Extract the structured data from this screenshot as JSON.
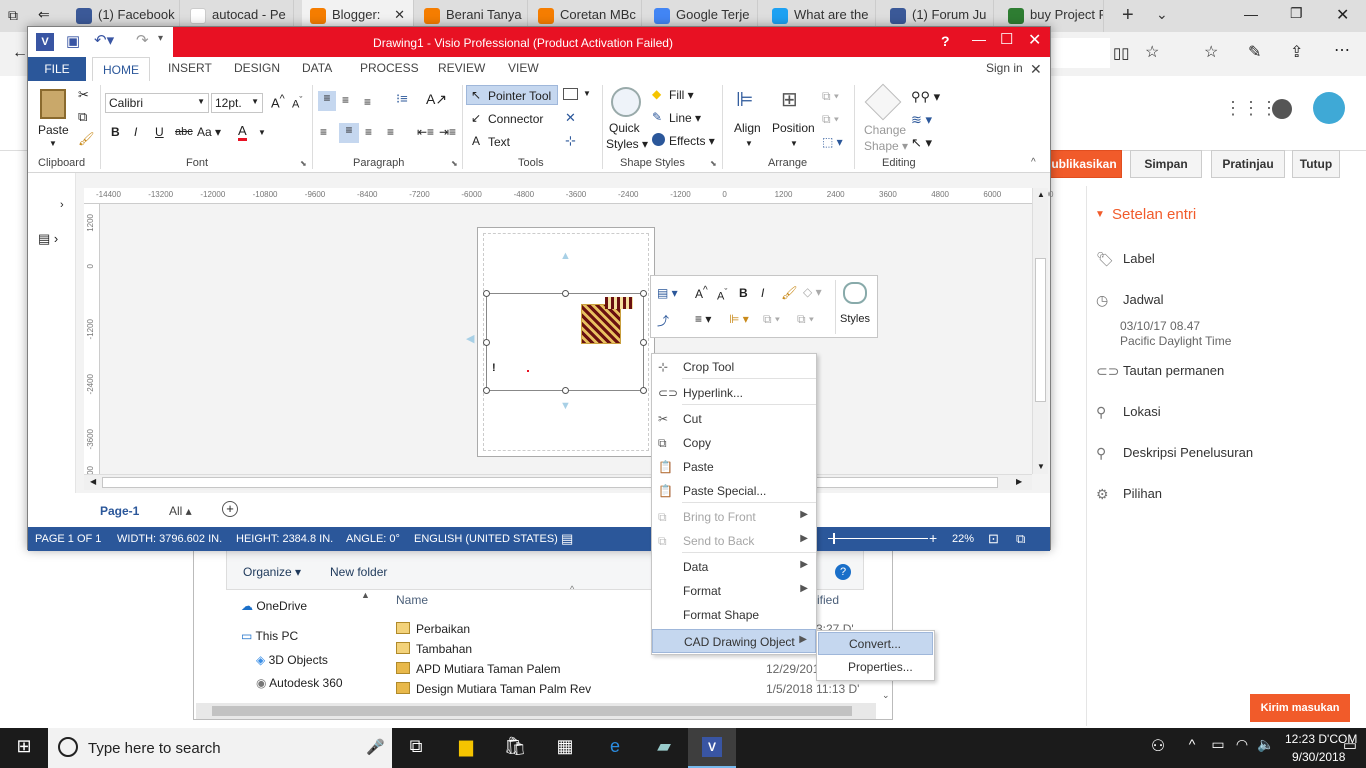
{
  "browser": {
    "tabs": [
      {
        "label": "(1) Facebook",
        "icon": "facebook-icon",
        "color": "#3b5998"
      },
      {
        "label": "autocad - Pe",
        "icon": "google-icon",
        "color": "#ffffff"
      },
      {
        "label": "Blogger:",
        "icon": "blogger-icon",
        "color": "#f57d00",
        "active": true
      },
      {
        "label": "Berani Tanya",
        "icon": "blogger-icon",
        "color": "#f57d00"
      },
      {
        "label": "Coretan MBc",
        "icon": "blogger-icon",
        "color": "#f57d00"
      },
      {
        "label": "Google Terje",
        "icon": "translate-icon",
        "color": "#4285f4"
      },
      {
        "label": "What are the",
        "icon": "twitter-icon",
        "color": "#1da1f2"
      },
      {
        "label": "(1) Forum Ju",
        "icon": "facebook-icon",
        "color": "#3b5998"
      },
      {
        "label": "buy Project P",
        "icon": "money-icon",
        "color": "#2e7d32"
      }
    ]
  },
  "blogger": {
    "buttons": {
      "publish": "ublikasikan",
      "save": "Simpan",
      "preview": "Pratinjau",
      "close": "Tutup"
    },
    "settings_title": "Setelan entri",
    "items": {
      "label": "Label",
      "schedule": "Jadwal",
      "schedule_date": "03/10/17 08.47",
      "schedule_tz": "Pacific Daylight Time",
      "permalink": "Tautan permanen",
      "location": "Lokasi",
      "search_desc": "Deskripsi Penelusuran",
      "options": "Pilihan"
    },
    "feedback": "Kirim masukan"
  },
  "visio": {
    "title": "Drawing1 -  Visio Professional (Product Activation Failed)",
    "signin": "Sign in",
    "tabs": [
      "FILE",
      "HOME",
      "INSERT",
      "DESIGN",
      "DATA",
      "PROCESS",
      "REVIEW",
      "VIEW"
    ],
    "ribbon": {
      "paste": "Paste",
      "font_name": "Calibri",
      "font_size": "12pt.",
      "pointer_tool": "Pointer Tool",
      "connector": "Connector",
      "text": "Text",
      "quick_styles_1": "Quick",
      "quick_styles_2": "Styles",
      "fill": "Fill",
      "line": "Line",
      "effects": "Effects",
      "align": "Align",
      "position": "Position",
      "change_shape_1": "Change",
      "change_shape_2": "Shape",
      "groups": {
        "clipboard": "Clipboard",
        "font": "Font",
        "paragraph": "Paragraph",
        "tools": "Tools",
        "shape_styles": "Shape Styles",
        "arrange": "Arrange",
        "editing": "Editing"
      }
    },
    "ruler_labels": [
      "-14400",
      "-13200",
      "-12000",
      "-10800",
      "-9600",
      "-8400",
      "-7200",
      "-6000",
      "-4800",
      "-3600",
      "-2400",
      "-1200",
      "0",
      "1200",
      "2400",
      "3600",
      "4800",
      "6000",
      "7200"
    ],
    "vruler_labels": [
      "1200",
      "0",
      "-1200",
      "-2400",
      "-3600",
      "-300"
    ],
    "page_tab": "Page-1",
    "all_tab": "All",
    "status": {
      "page": "PAGE 1 OF 1",
      "width": "WIDTH: 3796.602 IN.",
      "height": "HEIGHT: 2384.8 IN.",
      "angle": "ANGLE: 0°",
      "lang": "ENGLISH (UNITED STATES)",
      "zoom": "22%"
    },
    "mini_toolbar": {
      "styles": "Styles"
    },
    "context_menu": [
      {
        "label": "Crop Tool",
        "icon": "crop-icon",
        "disabled": false,
        "submenu": false
      },
      {
        "label": "Hyperlink...",
        "icon": "hyperlink-icon",
        "disabled": false,
        "submenu": false
      },
      {
        "label": "Cut",
        "icon": "cut-icon",
        "disabled": false,
        "submenu": false
      },
      {
        "label": "Copy",
        "icon": "copy-icon",
        "disabled": false,
        "submenu": false
      },
      {
        "label": "Paste",
        "icon": "paste-icon",
        "disabled": false,
        "submenu": false
      },
      {
        "label": "Paste Special...",
        "icon": "paste-special-icon",
        "disabled": false,
        "submenu": false
      },
      {
        "label": "Bring to Front",
        "icon": "bring-front-icon",
        "disabled": true,
        "submenu": true
      },
      {
        "label": "Send to Back",
        "icon": "send-back-icon",
        "disabled": true,
        "submenu": true
      },
      {
        "label": "Data",
        "icon": "",
        "disabled": false,
        "submenu": true
      },
      {
        "label": "Format",
        "icon": "",
        "disabled": false,
        "submenu": true
      },
      {
        "label": "Format Shape",
        "icon": "",
        "disabled": false,
        "submenu": false
      },
      {
        "label": "CAD Drawing Object",
        "icon": "",
        "disabled": false,
        "submenu": true,
        "highlighted": true
      }
    ],
    "submenu": [
      {
        "label": "Convert...",
        "highlighted": true
      },
      {
        "label": "Properties...",
        "highlighted": false
      }
    ]
  },
  "explorer": {
    "organize": "Organize",
    "new_folder": "New folder",
    "name_col": "Name",
    "modified_col": "ified",
    "nav": [
      "OneDrive",
      "This PC",
      "3D Objects",
      "Autodesk 360"
    ],
    "files": [
      {
        "name": "Perbaikan",
        "date": "3:27 D'"
      },
      {
        "name": "Tambahan",
        "date": ""
      },
      {
        "name": "APD Mutiara Taman Palem",
        "date": "12/29/201"
      },
      {
        "name": "Design Mutiara Taman Palm Rev",
        "date": "1/5/2018 11:13 D'"
      }
    ]
  },
  "taskbar": {
    "search": "Type here to search",
    "time": "12:23 D'COM",
    "date": "9/30/2018"
  }
}
